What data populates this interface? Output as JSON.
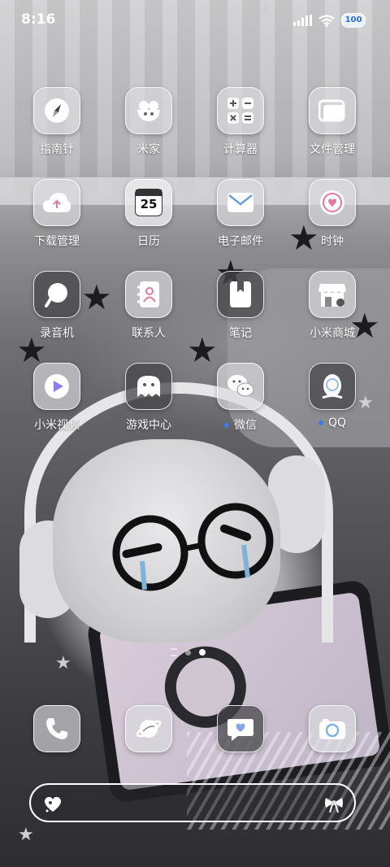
{
  "status_bar": {
    "time": "8:16",
    "battery": "100"
  },
  "home": {
    "row1": [
      {
        "label": "指南针",
        "icon": "compass-icon"
      },
      {
        "label": "米家",
        "icon": "mi-home-icon"
      },
      {
        "label": "计算器",
        "icon": "calculator-icon"
      },
      {
        "label": "文件管理",
        "icon": "folder-icon"
      }
    ],
    "row2": [
      {
        "label": "下载管理",
        "icon": "download-cloud-icon"
      },
      {
        "label": "日历",
        "icon": "calendar-icon",
        "day": "25"
      },
      {
        "label": "电子邮件",
        "icon": "mail-icon"
      },
      {
        "label": "时钟",
        "icon": "clock-icon"
      }
    ],
    "row3": [
      {
        "label": "录音机",
        "icon": "recorder-icon"
      },
      {
        "label": "联系人",
        "icon": "contacts-icon"
      },
      {
        "label": "笔记",
        "icon": "notes-icon"
      },
      {
        "label": "小米商城",
        "icon": "store-icon"
      }
    ],
    "row4": [
      {
        "label": "小米视频",
        "icon": "video-play-icon"
      },
      {
        "label": "游戏中心",
        "icon": "ghost-icon"
      },
      {
        "label": "微信",
        "icon": "wechat-icon",
        "new": true
      },
      {
        "label": "QQ",
        "icon": "qq-penguin-icon",
        "new": true
      }
    ]
  },
  "dock": [
    {
      "icon": "phone-icon"
    },
    {
      "icon": "browser-icon"
    },
    {
      "icon": "messages-icon"
    },
    {
      "icon": "camera-icon"
    }
  ],
  "colors": {
    "accent_dot": "#3b7be8",
    "battery_text": "#2b6fd8"
  }
}
